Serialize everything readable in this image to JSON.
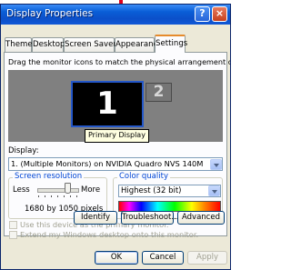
{
  "window": {
    "title": "Display Properties",
    "help_label": "?",
    "close_label": "×"
  },
  "tabs": [
    "Themes",
    "Desktop",
    "Screen Saver",
    "Appearance",
    "Settings"
  ],
  "active_tab": "Settings",
  "settings": {
    "instructions": "Drag the monitor icons to match the physical arrangement of your monitors.",
    "monitors": {
      "primary_number": "1",
      "secondary_number": "2",
      "tooltip": "Primary Display"
    },
    "display_label": "Display:",
    "display_value": "1. (Multiple Monitors) on NVIDIA Quadro NVS 140M",
    "screen_resolution": {
      "title": "Screen resolution",
      "less_label": "Less",
      "more_label": "More",
      "value_label": "1680 by 1050 pixels",
      "slider_level": 0.75
    },
    "color_quality": {
      "title": "Color quality",
      "value": "Highest (32 bit)"
    },
    "checkboxes": [
      "Use this device as the primary monitor.",
      "Extend my Windows desktop onto this monitor."
    ],
    "buttons": {
      "identify": "Identify",
      "troubleshoot": "Troubleshoot...",
      "advanced": "Advanced"
    }
  },
  "footer_buttons": {
    "ok": "OK",
    "cancel": "Cancel",
    "apply": "Apply"
  },
  "colors": {
    "title_bar": "#0b4fc9",
    "dialog_bg": "#ece9d8",
    "annotation_arrow": "#e0001b",
    "monitor_selected_border": "#2457c8"
  }
}
